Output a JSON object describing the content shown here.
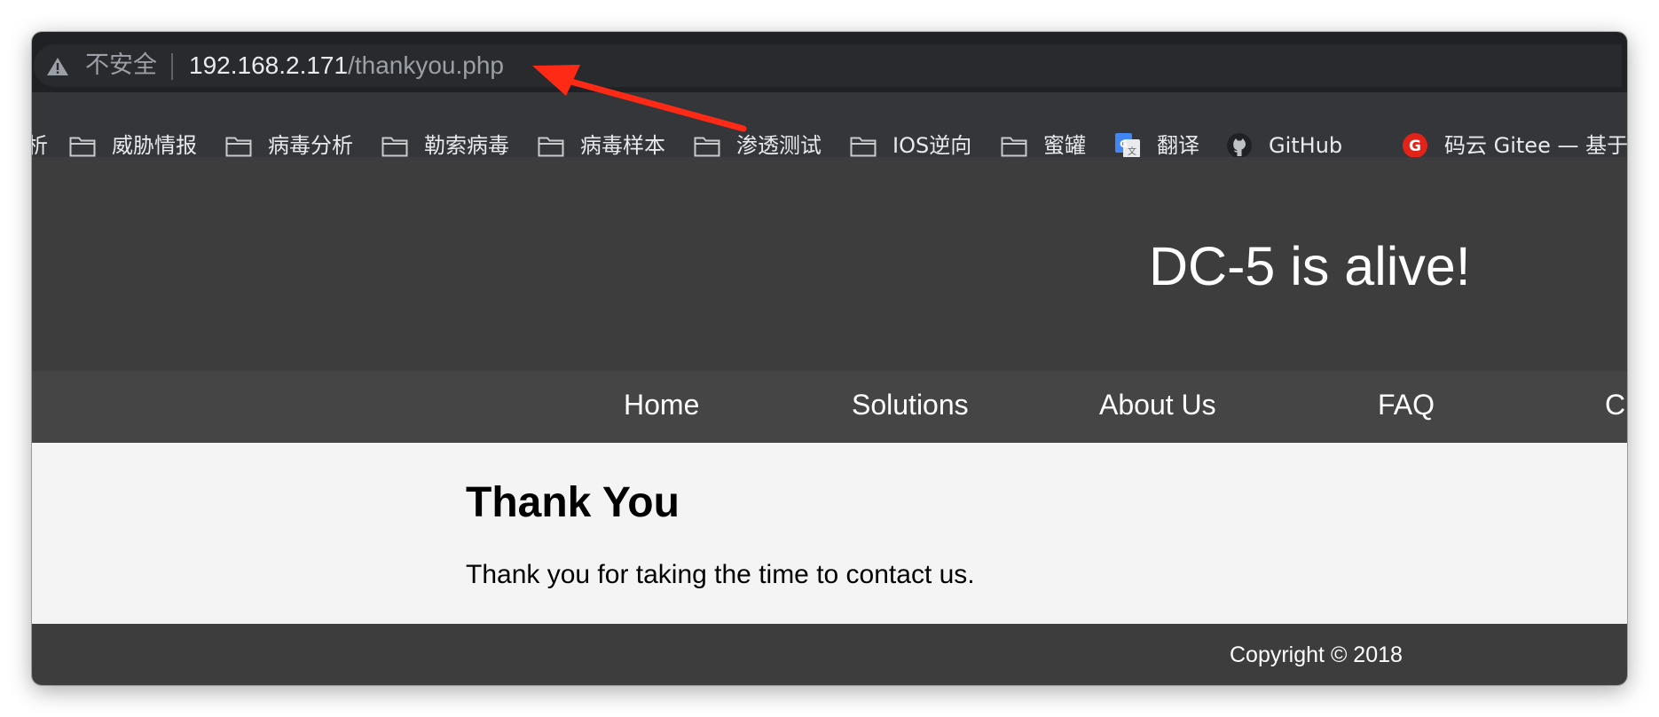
{
  "browser": {
    "security_label": "不安全",
    "url_host": "192.168.2.171",
    "url_path": "/thankyou.php"
  },
  "bookmarks": {
    "partial_label": "析",
    "items": [
      {
        "label": "威胁情报",
        "icon": "folder-icon"
      },
      {
        "label": "病毒分析",
        "icon": "folder-icon"
      },
      {
        "label": "勒索病毒",
        "icon": "folder-icon"
      },
      {
        "label": "病毒样本",
        "icon": "folder-icon"
      },
      {
        "label": "渗透测试",
        "icon": "folder-icon"
      },
      {
        "label": "IOS逆向",
        "icon": "folder-icon"
      },
      {
        "label": "蜜罐",
        "icon": "folder-icon"
      },
      {
        "label": "翻译",
        "icon": "google-translate-icon"
      },
      {
        "label": "GitHub",
        "icon": "github-icon"
      },
      {
        "label": "码云 Gitee — 基于...",
        "icon": "gitee-icon"
      }
    ]
  },
  "site": {
    "title": "DC-5 is alive!",
    "nav": [
      "Home",
      "Solutions",
      "About Us",
      "FAQ",
      "C"
    ],
    "heading": "Thank You",
    "message": "Thank you for taking the time to contact us.",
    "copyright": "Copyright © 2018"
  },
  "colors": {
    "header_bg": "#3d3d3d",
    "nav_bg": "#454545",
    "content_bg": "#f4f4f4",
    "annotation_arrow": "#ff2a16"
  }
}
